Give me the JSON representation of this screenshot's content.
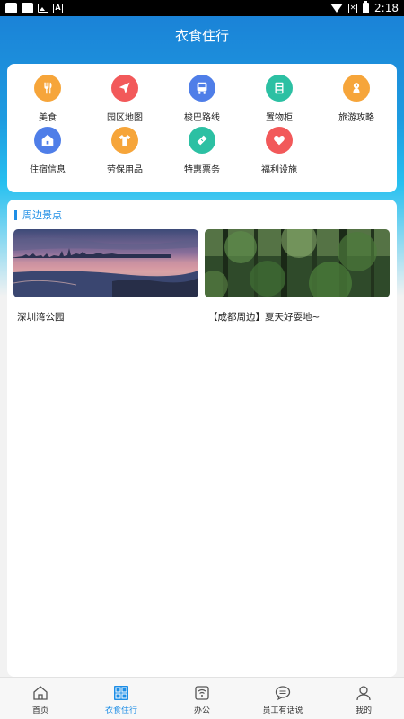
{
  "status_bar": {
    "time": "2:18"
  },
  "header": {
    "title": "衣食住行"
  },
  "menu": {
    "items": [
      {
        "label": "美食",
        "icon": "food-icon",
        "color": "#f6a53a"
      },
      {
        "label": "园区地图",
        "icon": "map-navigation-icon",
        "color": "#f2595a"
      },
      {
        "label": "梭巴路线",
        "icon": "bus-icon",
        "color": "#4f7ee8"
      },
      {
        "label": "置物柜",
        "icon": "locker-icon",
        "color": "#2cc0a3"
      },
      {
        "label": "旅游攻略",
        "icon": "travel-guide-icon",
        "color": "#f6a53a"
      },
      {
        "label": "住宿信息",
        "icon": "home-icon",
        "color": "#4f7ee8"
      },
      {
        "label": "劳保用品",
        "icon": "shirt-icon",
        "color": "#f6a53a"
      },
      {
        "label": "特惠票务",
        "icon": "ticket-icon",
        "color": "#2cc0a3"
      },
      {
        "label": "福利设施",
        "icon": "heart-icon",
        "color": "#f2595a"
      }
    ]
  },
  "scenic": {
    "title": "周边景点",
    "items": [
      {
        "caption": "深圳湾公园",
        "image": "bay-skyline-sunset-image"
      },
      {
        "caption": "【成都周边】夏天好耍地~",
        "image": "forest-image"
      }
    ]
  },
  "bottom_nav": {
    "items": [
      {
        "label": "首页",
        "icon": "home-icon",
        "active": false
      },
      {
        "label": "衣食住行",
        "icon": "grid-icon",
        "active": true
      },
      {
        "label": "办公",
        "icon": "office-icon",
        "active": false
      },
      {
        "label": "员工有话说",
        "icon": "chat-icon",
        "active": false
      },
      {
        "label": "我的",
        "icon": "user-icon",
        "active": false
      }
    ]
  },
  "colors": {
    "primary": "#1e8ee6",
    "header_gradient_top": "#1a7fd6",
    "header_gradient_bottom": "#27c0f0"
  }
}
